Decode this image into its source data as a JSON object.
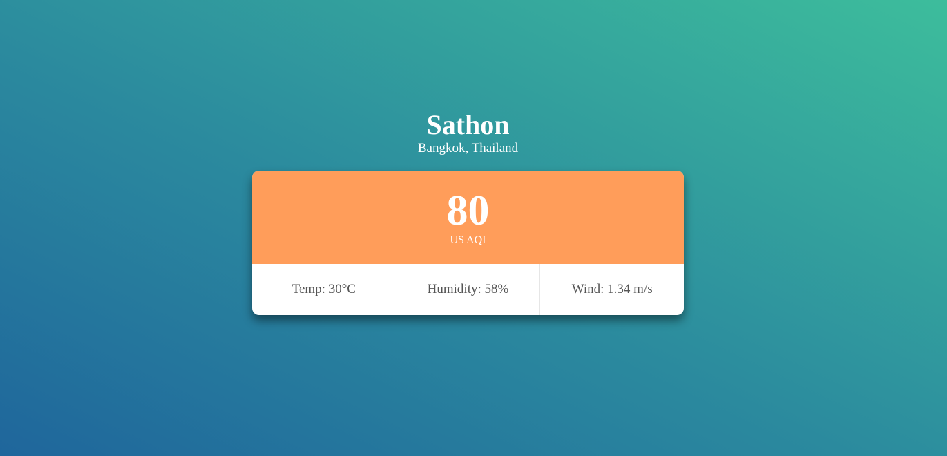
{
  "location": {
    "city": "Sathon",
    "region": "Bangkok, Thailand"
  },
  "aqi": {
    "value": "80",
    "unit": "US AQI",
    "color": "#ff9d5a"
  },
  "stats": [
    {
      "label": "Temp: 30°C"
    },
    {
      "label": "Humidity: 58%"
    },
    {
      "label": "Wind: 1.34 m/s"
    }
  ]
}
